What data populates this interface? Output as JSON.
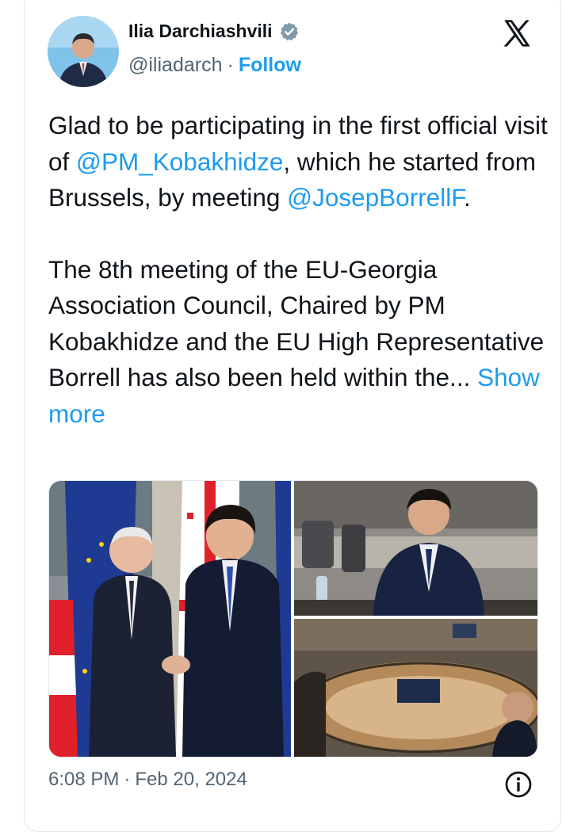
{
  "author": {
    "name": "Ilia Darchiashvili",
    "handle": "@iliadarch",
    "separator": "·",
    "follow_label": "Follow",
    "verified_color": "#829aab"
  },
  "tweet": {
    "p1_a": "Glad to be participating in the first official visit of ",
    "mention1": "@PM_Kobakhidze",
    "p1_b": ", which he started from Brussels, by meeting ",
    "mention2": "@JosepBorrellF",
    "p1_c": ".",
    "p2": "The 8th meeting of the EU-Georgia Association Council, Chaired by PM Kobakhidze and the EU High Representative Borrell has also been held within the...",
    "show_more": "Show more"
  },
  "footer": {
    "time": "6:08 PM",
    "separator": "·",
    "date": "Feb 20, 2024"
  },
  "icons": {
    "platform": "x-logo-icon",
    "verified": "verified-badge-icon",
    "info": "info-icon"
  },
  "colors": {
    "link": "#1d9bf0",
    "secondary_text": "#536471",
    "primary_text": "#0f1419"
  }
}
